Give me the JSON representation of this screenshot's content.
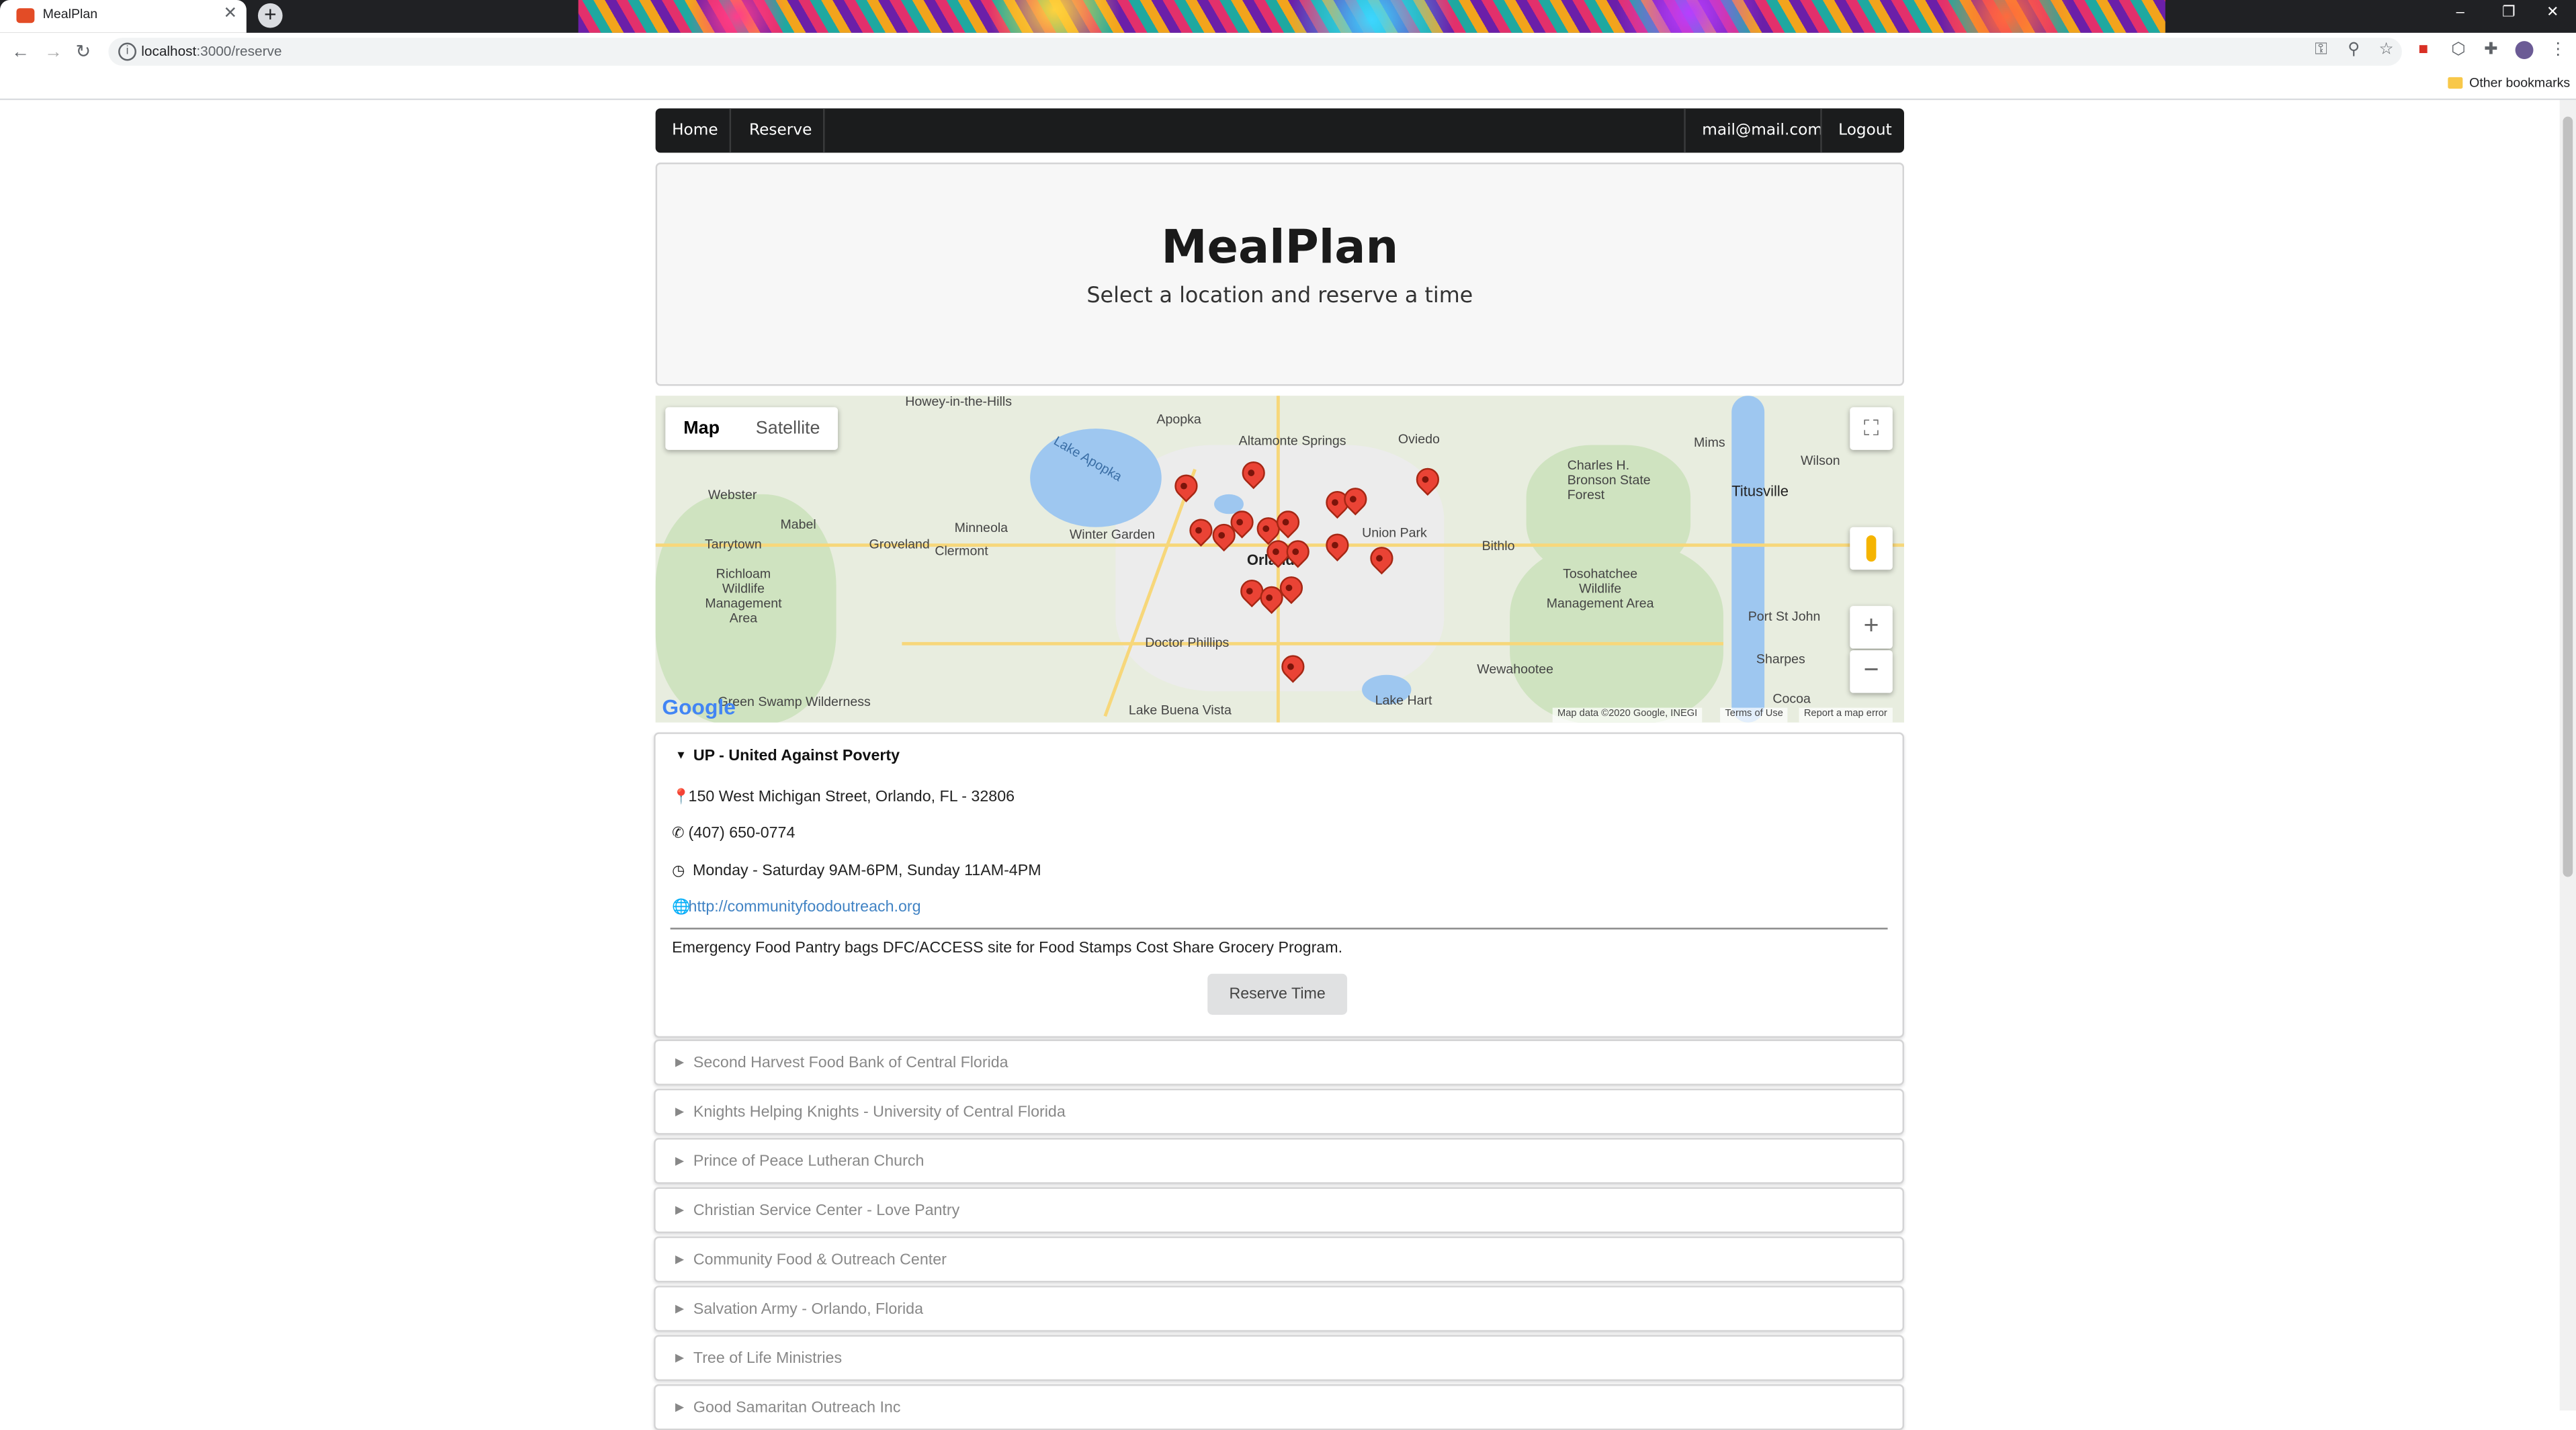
{
  "browser": {
    "tab_title": "MealPlan",
    "url_host": "localhost",
    "url_path": ":3000/reserve",
    "bookmarks_label": "Other bookmarks"
  },
  "nav": {
    "home": "Home",
    "reserve": "Reserve",
    "user_email": "mail@mail.com",
    "logout": "Logout"
  },
  "hero": {
    "title": "MealPlan",
    "subtitle": "Select a location and reserve a time"
  },
  "map": {
    "type_map": "Map",
    "type_satellite": "Satellite",
    "google_logo": "Google",
    "map_data": "Map data ©2020 Google, INEGI",
    "terms": "Terms of Use",
    "report": "Report a map error",
    "places": {
      "apopka": "Apopka",
      "altamonte": "Altamonte Springs",
      "oviedo": "Oviedo",
      "webster": "Webster",
      "mabel": "Mabel",
      "minneola": "Minneola",
      "winter_garden": "Winter Garden",
      "orlando": "Orlando",
      "union_park": "Union Park",
      "bithlo": "Bithlo",
      "tarrytown": "Tarrytown",
      "groveland": "Groveland",
      "clermont": "Clermont",
      "richloam": "Richloam Wildlife Management Area",
      "lake_apopka": "Lake Apopka",
      "charles_bronson": "Charles H. Bronson State Forest",
      "titusville": "Titusville",
      "tosohatchee": "Tosohatchee Wildlife Management Area",
      "doctor_phillips": "Doctor Phillips",
      "wewahootee": "Wewahootee",
      "lake_hart": "Lake Hart",
      "lake_buena_vista": "Lake Buena Vista",
      "green_swamp": "Green Swamp Wilderness",
      "port_st_john": "Port St John",
      "sharpes": "Sharpes",
      "cocoa": "Cocoa",
      "howey": "Howey-in-the-Hills",
      "mims": "Mims",
      "wilson": "Wilson"
    }
  },
  "selected": {
    "name": "UP - United Against Poverty",
    "address": "150 West Michigan Street, Orlando, FL - 32806",
    "phone": "(407) 650-0774",
    "hours": "Monday - Saturday 9AM-6PM, Sunday 11AM-4PM",
    "website": "http://communityfoodoutreach.org",
    "description": "Emergency Food Pantry bags DFC/ACCESS site for Food Stamps Cost Share Grocery Program.",
    "reserve_label": "Reserve Time"
  },
  "locations": [
    "Second Harvest Food Bank of Central Florida",
    "Knights Helping Knights - University of Central Florida",
    "Prince of Peace Lutheran Church",
    "Christian Service Center - Love Pantry",
    "Community Food & Outreach Center",
    "Salvation Army - Orlando, Florida",
    "Tree of Life Ministries",
    "Good Samaritan Outreach Inc"
  ]
}
